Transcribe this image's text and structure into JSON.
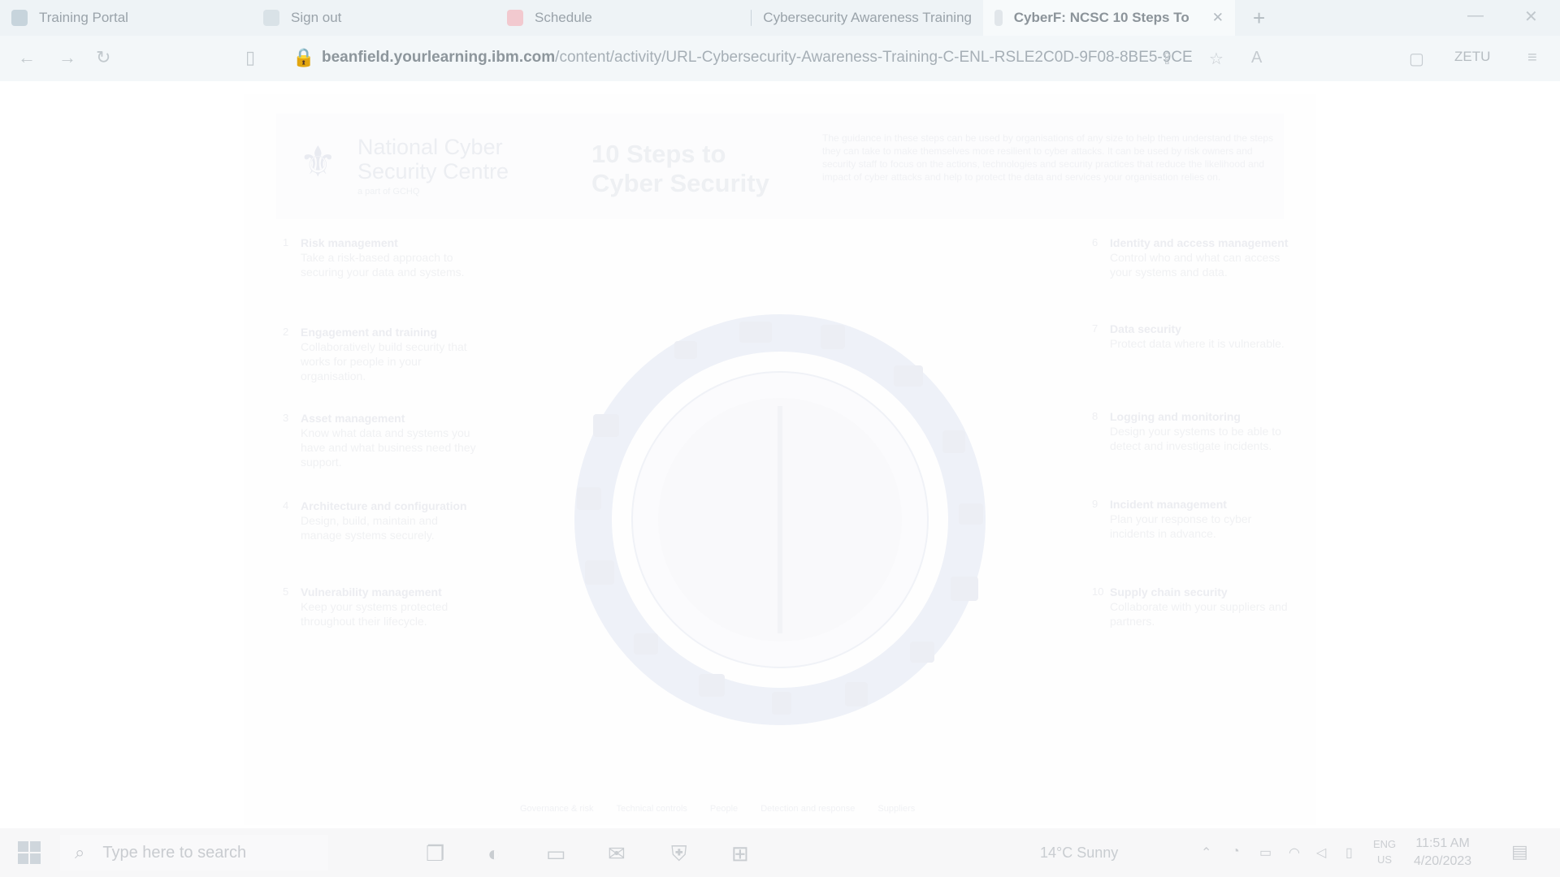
{
  "browser": {
    "tabs": [
      {
        "label": "Training Portal",
        "color": "#c7d4dc"
      },
      {
        "label": "Sign out",
        "color": "#d9e2e7"
      },
      {
        "label": "Schedule",
        "color": "#f2c9cf"
      },
      {
        "label": "Cybersecurity Awareness Training",
        "color": "#c9d3db"
      },
      {
        "label": "CyberF: NCSC 10 Steps To",
        "color": "#e1e6ea",
        "active": true
      }
    ],
    "new_tab": "+",
    "url_host": "beanfield.yourlearning.ibm.com",
    "url_path": "/content/activity/URL-Cybersecurity-Awareness-Training-C-ENL-RSLE2C0D-9F08-8BE5-9CE",
    "profile_label": "ZETU"
  },
  "document": {
    "org_name": "National Cyber Security Centre",
    "org_sub": "a part of GCHQ",
    "title": "10 Steps to Cyber Security",
    "intro": "The guidance in these steps can be used by organisations of any size to help them understand the steps they can take to make themselves more resilient to cyber attacks. It can be used by risk owners and security staff to focus on the actions, technologies and security practices that reduce the likelihood and impact of cyber attacks and help to protect the data and services your organisation relies on.",
    "steps_left": [
      {
        "num": "1",
        "title": "Risk management",
        "text": "Take a risk-based approach to securing your data and systems."
      },
      {
        "num": "2",
        "title": "Engagement and training",
        "text": "Collaboratively build security that works for people in your organisation."
      },
      {
        "num": "3",
        "title": "Asset management",
        "text": "Know what data and systems you have and what business need they support."
      },
      {
        "num": "4",
        "title": "Architecture and configuration",
        "text": "Design, build, maintain and manage systems securely."
      },
      {
        "num": "5",
        "title": "Vulnerability management",
        "text": "Keep your systems protected throughout their lifecycle."
      }
    ],
    "steps_right": [
      {
        "num": "6",
        "title": "Identity and access management",
        "text": "Control who and what can access your systems and data."
      },
      {
        "num": "7",
        "title": "Data security",
        "text": "Protect data where it is vulnerable."
      },
      {
        "num": "8",
        "title": "Logging and monitoring",
        "text": "Design your systems to be able to detect and investigate incidents."
      },
      {
        "num": "9",
        "title": "Incident management",
        "text": "Plan your response to cyber incidents in advance."
      },
      {
        "num": "10",
        "title": "Supply chain security",
        "text": "Collaborate with your suppliers and partners."
      }
    ],
    "legend": [
      "Governance & risk",
      "Technical controls",
      "People",
      "Detection and response",
      "Suppliers"
    ]
  },
  "taskbar": {
    "search_placeholder": "Type here to search",
    "weather": "14°C  Sunny",
    "lang_top": "ENG",
    "lang_bottom": "US",
    "time": "11:51 AM",
    "date": "4/20/2023"
  }
}
